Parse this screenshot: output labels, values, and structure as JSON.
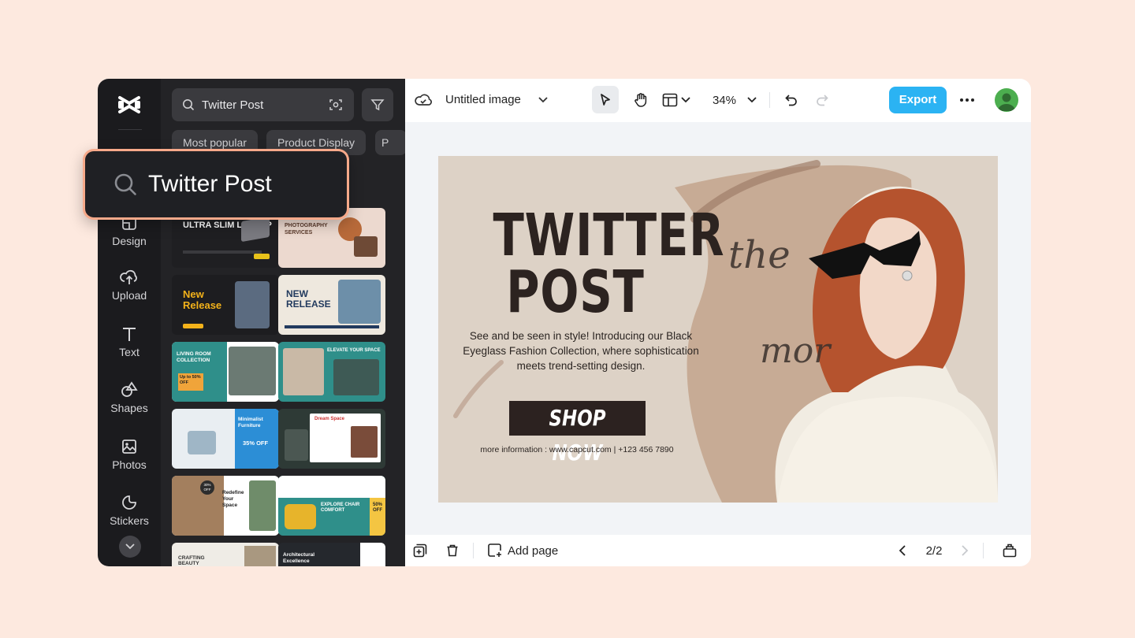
{
  "panel": {
    "search_value": "Twitter Post",
    "chips": [
      "Most popular",
      "Product Display",
      "P"
    ]
  },
  "callout": {
    "text": "Twitter Post"
  },
  "rail": {
    "items": [
      {
        "label": "Design",
        "icon": "design-icon"
      },
      {
        "label": "Upload",
        "icon": "upload-icon"
      },
      {
        "label": "Text",
        "icon": "text-icon"
      },
      {
        "label": "Shapes",
        "icon": "shapes-icon"
      },
      {
        "label": "Photos",
        "icon": "photos-icon"
      },
      {
        "label": "Stickers",
        "icon": "stickers-icon"
      }
    ]
  },
  "templates": [
    {
      "title": "ULTRA SLIM LAPTOP",
      "theme": "dark"
    },
    {
      "title": "PHOTOGRAPHY SERVICES",
      "theme": "pink"
    },
    {
      "title": "New Release",
      "theme": "dark"
    },
    {
      "title": "NEW RELEASE",
      "theme": "light"
    },
    {
      "title": "LIVING ROOM COLLECTION",
      "badge": "Up to 50% OFF",
      "theme": "teal"
    },
    {
      "title": "ELEVATE YOUR SPACE",
      "theme": "teal"
    },
    {
      "title": "Minimalist Furniture",
      "badge": "35% OFF",
      "theme": "blue"
    },
    {
      "title": "Dream Space",
      "theme": "green"
    },
    {
      "title": "Redefine Your Space",
      "badge": "30% OFF",
      "theme": "white"
    },
    {
      "title": "EXPLORE CHAIR COMFORT",
      "badge": "50% OFF",
      "theme": "teal"
    },
    {
      "title": "CRAFTING BEAUTY",
      "theme": "light"
    },
    {
      "title": "Architectural Excellence",
      "theme": "dark"
    }
  ],
  "editor": {
    "doc_title": "Untitled image",
    "zoom": "34%",
    "export_label": "Export",
    "add_page_label": "Add page",
    "page_indicator": "2/2"
  },
  "poster": {
    "headline_line1": "TWITTER",
    "headline_line2": "POST",
    "body": "See and be seen in style! Introducing our Black Eyeglass Fashion Collection, where sophistication meets trend-setting design.",
    "cta": "SHOP NOW",
    "contact": "more information : www.capcut.com | +123 456 7890",
    "script_word1": "the",
    "script_word2": "mor"
  },
  "colors": {
    "accent": "#2bb3f3",
    "callout_border": "#f6a98a",
    "page_bg": "#fde9df",
    "poster_bg": "#ddd2c6"
  }
}
